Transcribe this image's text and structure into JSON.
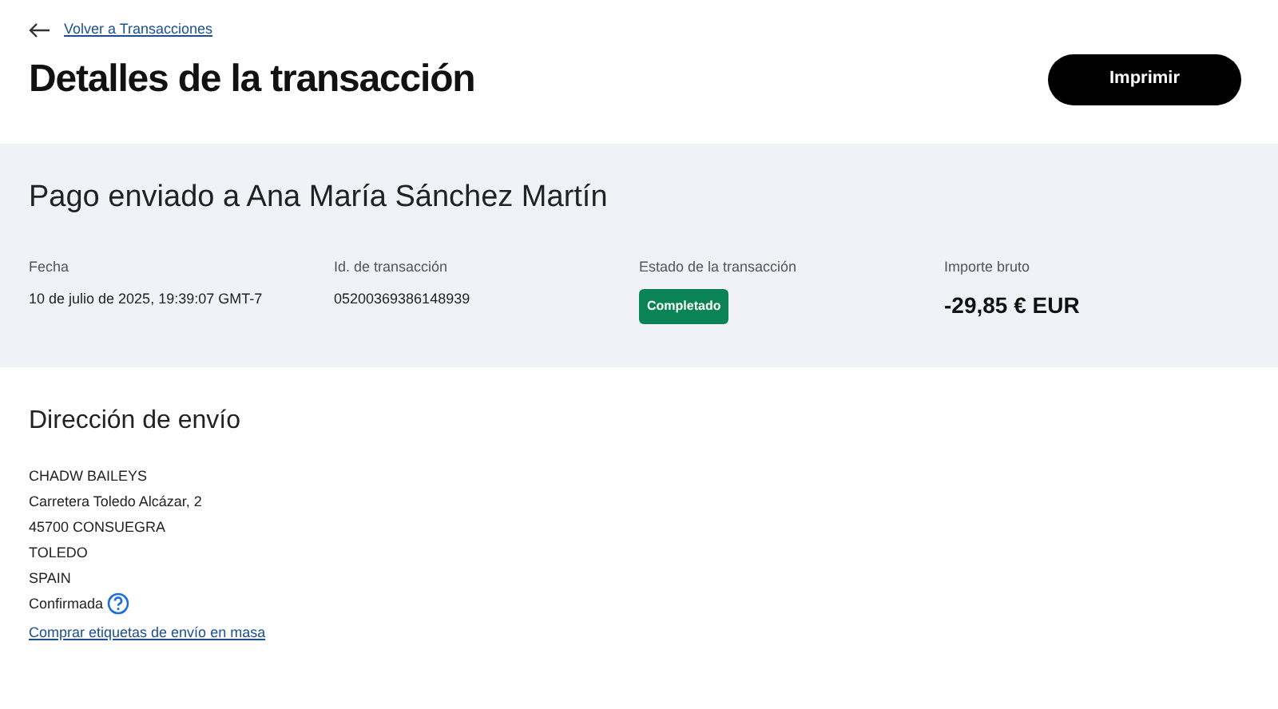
{
  "back_link": "Volver a Transacciones",
  "title": "Detalles de la transacción",
  "print_button": "Imprimir",
  "summary": {
    "heading": "Pago enviado a Ana María Sánchez Martín",
    "fields": [
      {
        "label": "Fecha",
        "value": "10 de julio de 2025, 19:39:07 GMT-7",
        "kind": "text"
      },
      {
        "label": "Id. de transacción",
        "value": "05200369386148939",
        "kind": "text"
      },
      {
        "label": "Estado de la transacción",
        "value": "Completado",
        "kind": "badge"
      },
      {
        "label": "Importe bruto",
        "value": "-29,85 € EUR",
        "kind": "amount"
      }
    ]
  },
  "shipping": {
    "heading": "Dirección de envío",
    "lines": [
      "CHADW BAILEYS",
      "Carretera Toledo Alcázar, 2",
      "45700 CONSUEGRA",
      "TOLEDO",
      "SPAIN"
    ],
    "confirmed_label": "Confirmada",
    "link": "Comprar etiquetas de envío en masa"
  }
}
